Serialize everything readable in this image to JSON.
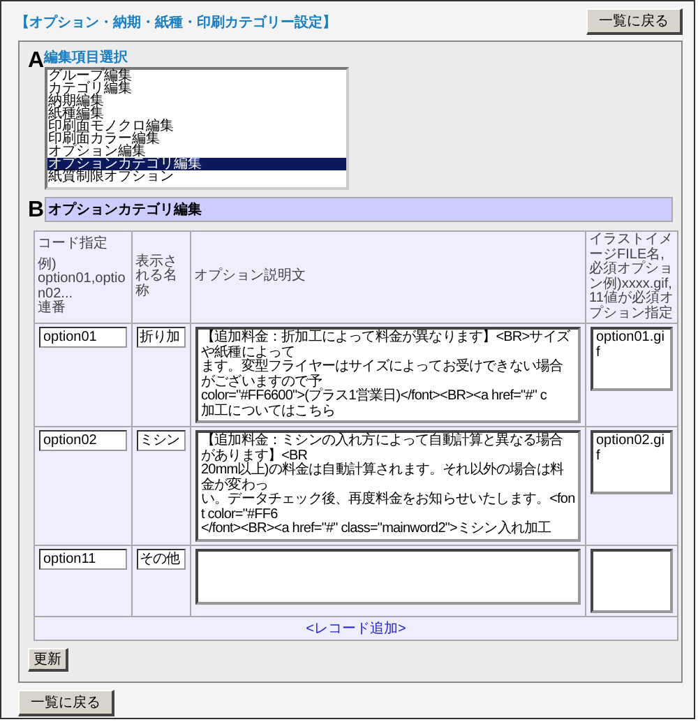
{
  "title": "【オプション・納期・紙種・印刷カテゴリー設定】",
  "top_button": "一覧に戻る",
  "section_a": {
    "marker": "A",
    "label": "編集項目選択",
    "items": [
      {
        "label": "グループ編集",
        "selected": false
      },
      {
        "label": "カテゴリ編集",
        "selected": false
      },
      {
        "label": "納期編集",
        "selected": false
      },
      {
        "label": "紙種編集",
        "selected": false
      },
      {
        "label": "印刷面モノクロ編集",
        "selected": false
      },
      {
        "label": "印刷面カラー編集",
        "selected": false
      },
      {
        "label": "オプション編集",
        "selected": false
      },
      {
        "label": "オプションカテゴリ編集",
        "selected": true
      },
      {
        "label": "紙質制限オプション",
        "selected": false
      }
    ]
  },
  "section_b": {
    "marker": "B",
    "title": "オプションカテゴリ編集"
  },
  "table": {
    "columns": [
      {
        "lines": [
          "コード指定",
          "例)",
          "option01,option02...",
          "連番"
        ]
      },
      {
        "lines": [
          "表示される名称"
        ]
      },
      {
        "lines": [
          "オプション説明文"
        ]
      },
      {
        "lines": [
          "イラストイメージFILE名,必須オプション例)xxxx.gif,11値が必須オプション指定"
        ]
      }
    ],
    "rows": [
      {
        "code": "option01",
        "name": "折り加",
        "description": [
          "【追加料金：折加工によって料金が異なります】<BR>サイズや紙種によって",
          "ます。変型フライヤーはサイズによってお受けできない場合がございますので予",
          "color=\"#FF6600\">(プラス1営業日)</font><BR><a href=\"#\" c",
          "加工についてはこちら"
        ],
        "image": "option01.gif"
      },
      {
        "code": "option02",
        "name": "ミシン",
        "description": [
          "【追加料金：ミシンの入れ方によって自動計算と異なる場合があります】<BR",
          "20mm以上)の料金は自動計算されます。それ以外の場合は料金が変わっ",
          "い。データチェック後、再度料金をお知らせいたします。<font color=\"#FF6",
          "</font><BR><a href=\"#\" class=\"mainword2\">ミシン入れ加工"
        ],
        "image": "option02.gif"
      },
      {
        "code": "option11",
        "name": "その他",
        "description": [],
        "image": ""
      }
    ],
    "add_link": "<レコード追加>"
  },
  "update_button": "更新",
  "bottom_button": "一覧に戻る"
}
